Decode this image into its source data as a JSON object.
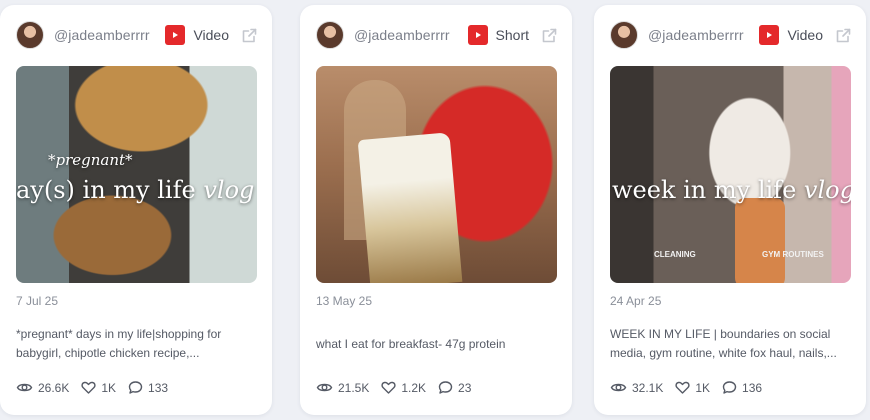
{
  "cards": [
    {
      "username": "@jadeamberrrr",
      "type": "Short",
      "date": "13 May 25",
      "caption": "what I eat for breakfast- 47g protein",
      "views": "21.5K",
      "likes": "1.2K",
      "comments": "23",
      "thumbnail_text": ""
    },
    {
      "username": "@jadeamberrrr",
      "type": "Video",
      "date": "24 Apr 25",
      "caption": "WEEK IN MY LIFE | boundaries on social media, gym routine, white fox haul, nails,...",
      "views": "32.1K",
      "likes": "1K",
      "comments": "136",
      "thumbnail_text": "week in my life",
      "thumbnail_script": "vlog",
      "thumbnail_label_left": "CLEANING",
      "thumbnail_label_right": "GYM ROUTINES"
    },
    {
      "username": "@jadeamberrrr",
      "type": "Video",
      "date": "7 Jul 25",
      "caption": "*pregnant* days in my life|shopping for babygirl, chipotle chicken recipe,...",
      "views": "26.6K",
      "likes": "1K",
      "comments": "133",
      "thumbnail_text": "ay(s) in my life",
      "thumbnail_script": "vlog",
      "thumbnail_top": "*pregnant*"
    }
  ],
  "colors": {
    "youtube_red": "#e4292b",
    "card_bg": "#ffffff",
    "page_bg": "#eef0f5"
  },
  "icons": {
    "platform": "youtube-icon",
    "external": "external-link-icon",
    "views": "eye-icon",
    "likes": "heart-icon",
    "comments": "comment-icon"
  }
}
